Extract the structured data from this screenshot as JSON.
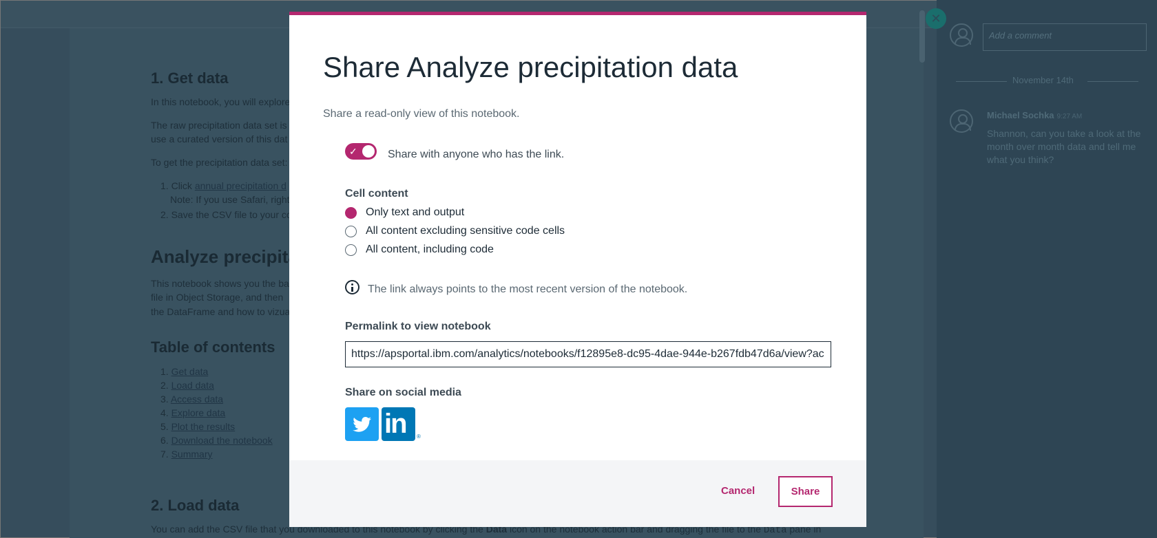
{
  "background": {
    "sections": [
      {
        "heading": "1. Get data",
        "lines": [
          "In this notebook, you will explore",
          "The raw precipitation data set is",
          "use a curated version of this dat",
          "To get the precipitation data set:"
        ]
      },
      {
        "list": [
          {
            "num": "1.",
            "pre": "Click ",
            "link": "annual precipitation d",
            "post": ""
          },
          {
            "num": "",
            "pre": "Note: If you use Safari, right",
            "link": "",
            "post": ""
          },
          {
            "num": "2.",
            "pre": "Save the CSV file to your co",
            "link": "",
            "post": ""
          }
        ]
      },
      {
        "heading": "Analyze precipita",
        "lines": [
          "This notebook shows you the ba",
          "file in Object Storage, and then",
          "the DataFrame and how to vizua"
        ]
      },
      {
        "heading": "Table of contents"
      }
    ],
    "toc": [
      "Get data",
      "Load data",
      "Access data",
      "Explore data",
      "Plot the results",
      "Download the notebook",
      "Summary"
    ],
    "toc_numbers": [
      "1.",
      "2.",
      "3.",
      "4.",
      "5.",
      "6.",
      "7."
    ],
    "load_heading": "2. Load data",
    "load_line_pre": "You can add the CSV file that you downloaded to this notebook by clicking the ",
    "load_line_bold": "Data",
    "load_line_mid": " icon on the notebook action bar and dragging the file to the ",
    "load_line_code": "Data",
    "load_line_post": " pane in"
  },
  "comments": {
    "placeholder": "Add a comment",
    "date": "November 14th",
    "author": "Michael Sochka",
    "time": "9:27 AM",
    "body": "Shannon, can you take a look at the month over month data and tell me what you think?"
  },
  "modal": {
    "title": "Share Analyze precipitation data",
    "subtitle": "Share a read-only view of this notebook.",
    "toggle_label": "Share with anyone who has the link.",
    "toggle_on": true,
    "cell_content_label": "Cell content",
    "options": [
      {
        "label": "Only text and output",
        "checked": true
      },
      {
        "label": "All content excluding sensitive code cells",
        "checked": false
      },
      {
        "label": "All content, including code",
        "checked": false
      }
    ],
    "info_text": "The link always points to the most recent version of the notebook.",
    "permalink_label": "Permalink to view notebook",
    "permalink_value": "https://apsportal.ibm.com/analytics/notebooks/f12895e8-dc95-4dae-944e-b267fdb47d6a/view?ac",
    "social_label": "Share on social media",
    "social": [
      {
        "icon": "twitter-icon",
        "color": "#1da1f2"
      },
      {
        "icon": "linkedin-icon",
        "color": "#0077b5",
        "text": "in"
      }
    ],
    "cancel_label": "Cancel",
    "share_label": "Share"
  },
  "colors": {
    "accent": "#b4276f",
    "overlay": "#2c4454"
  }
}
